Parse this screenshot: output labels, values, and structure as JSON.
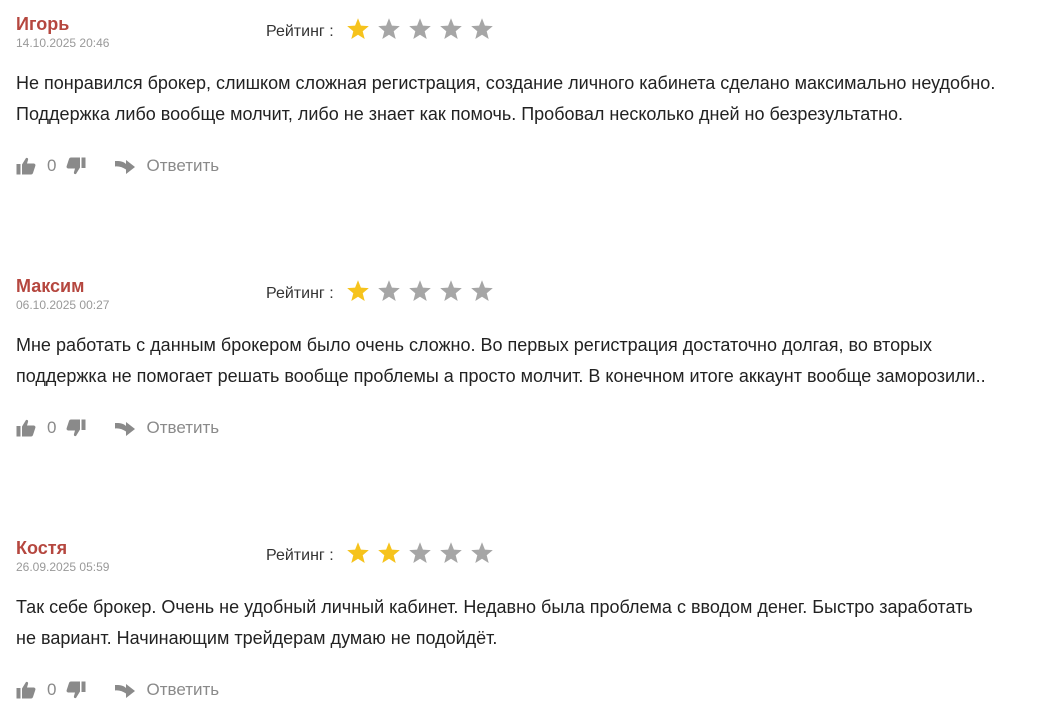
{
  "labels": {
    "rating": "Рейтинг :",
    "reply": "Ответить"
  },
  "colors": {
    "author": "#b5473f",
    "star_filled": "#f6c31c",
    "star_empty": "#a6a6a6",
    "muted": "#8a8a8a"
  },
  "reviews": [
    {
      "author": "Игорь",
      "date": "14.10.2025 20:46",
      "rating": 1,
      "max_rating": 5,
      "text_lines": [
        "Не понравился брокер, слишком сложная регистрация, создание личного кабинета сделано максимально неудобно.",
        "Поддержка либо вообще молчит, либо не знает как помочь. Пробовал несколько дней но безрезультатно."
      ],
      "likes": "0"
    },
    {
      "author": "Максим",
      "date": "06.10.2025 00:27",
      "rating": 1,
      "max_rating": 5,
      "text_lines": [
        "Мне работать с данным брокером было очень сложно. Во первых регистрация достаточно долгая, во вторых",
        "поддержка не помогает решать вообще проблемы а просто молчит. В конечном итоге аккаунт вообще заморозили.."
      ],
      "likes": "0"
    },
    {
      "author": "Костя",
      "date": "26.09.2025 05:59",
      "rating": 2,
      "max_rating": 5,
      "text_lines": [
        "Так себе брокер. Очень не удобный личный кабинет. Недавно была проблема с вводом денег. Быстро заработать",
        "не вариант. Начинающим трейдерам думаю не подойдёт."
      ],
      "likes": "0"
    }
  ]
}
